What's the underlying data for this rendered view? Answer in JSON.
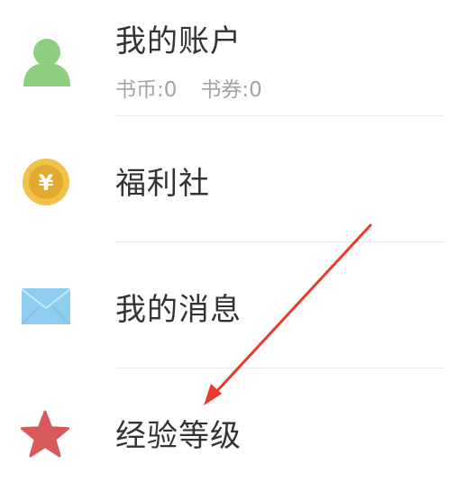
{
  "menu": {
    "account": {
      "title": "我的账户",
      "coins_label": "书币:0",
      "vouchers_label": "书券:0",
      "icon": "user-avatar-icon",
      "color": "#8ccf7e"
    },
    "welfare": {
      "title": "福利社",
      "icon": "yen-coin-icon",
      "icon_glyph": "¥",
      "color": "#f0c24a"
    },
    "messages": {
      "title": "我的消息",
      "icon": "envelope-icon",
      "color": "#8fcdf0"
    },
    "level": {
      "title": "经验等级",
      "icon": "star-icon",
      "color": "#d95a5a"
    }
  },
  "annotation": {
    "arrow_color": "#e83a2e",
    "points_to": "经验等级"
  }
}
